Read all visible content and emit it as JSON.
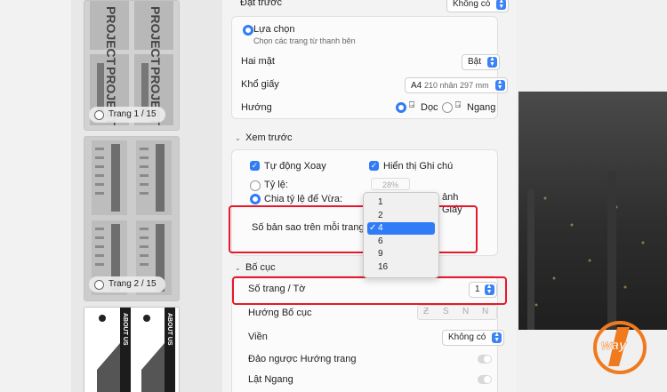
{
  "sidebar": {
    "pages": [
      {
        "label": "Trang 1 / 15",
        "thumb_text": "PROJECT"
      },
      {
        "label": "Trang 2 / 15"
      },
      {
        "thumb_text": "ABOUT US"
      }
    ]
  },
  "top": {
    "preset_label": "Đặt trước",
    "preset_value": "Không có"
  },
  "pages_group": {
    "selection_label": "Lựa chọn",
    "selection_sub": "Chọn các trang từ thanh bên",
    "duplex_label": "Hai mặt",
    "duplex_value": "Bật",
    "paper_label": "Khổ giấy",
    "paper_value": "A4",
    "paper_sub": "210 nhân 297 mm",
    "orientation_label": "Hướng",
    "portrait_label": "Dọc",
    "landscape_label": "Ngang"
  },
  "preview": {
    "header": "Xem trước",
    "auto_rotate": "Tự động Xoay",
    "show_notes": "Hiển thị Ghi chú",
    "scale_label": "Tỷ lệ:",
    "scale_value": "28%",
    "fit_label": "Chia tỷ lệ để Vừa:",
    "fit_partial_1": "ảnh",
    "fit_partial_2": "Giấy",
    "copies_label": "Số bản sao trên mỗi trang:"
  },
  "menu": {
    "options": [
      "1",
      "2",
      "4",
      "6",
      "9",
      "16"
    ],
    "selected": "4",
    "check": "✓"
  },
  "layout": {
    "header": "Bố cục",
    "pages_per_sheet_label": "Số trang / Tờ",
    "pages_per_sheet_value": "1",
    "direction_label": "Hướng Bố cục",
    "border_label": "Viền",
    "border_value": "Không có",
    "reverse_label": "Đảo ngược Hướng trang",
    "flip_label": "Lật Ngang"
  },
  "logo": {
    "text": "way"
  },
  "colors": {
    "accent": "#2f7cf6",
    "highlight": "#e8172b",
    "logo": "#f07a1e"
  }
}
